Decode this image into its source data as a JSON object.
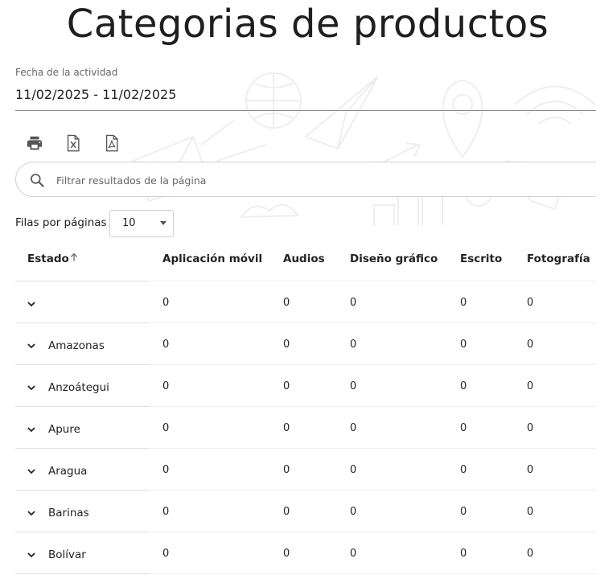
{
  "header": {
    "title": "Categorias de productos"
  },
  "filters": {
    "date_label": "Fecha de la actividad",
    "date_value": "11/02/2025 - 11/02/2025"
  },
  "search": {
    "placeholder": "Filtrar resultados de la página",
    "value": ""
  },
  "pagination": {
    "rows_label": "Filas por páginas",
    "rows_value": "10"
  },
  "table": {
    "columns": [
      "Estado",
      "Aplicación móvil",
      "Audios",
      "Diseño gráfico",
      "Escrito",
      "Fotografía"
    ],
    "sort": {
      "column": "Estado",
      "direction": "ascending"
    },
    "rows": [
      {
        "estado": "",
        "values": [
          "0",
          "0",
          "0",
          "0",
          "0"
        ]
      },
      {
        "estado": "Amazonas",
        "values": [
          "0",
          "0",
          "0",
          "0",
          "0"
        ]
      },
      {
        "estado": "Anzoátegui",
        "values": [
          "0",
          "0",
          "0",
          "0",
          "0"
        ]
      },
      {
        "estado": "Apure",
        "values": [
          "0",
          "0",
          "0",
          "0",
          "0"
        ]
      },
      {
        "estado": "Aragua",
        "values": [
          "0",
          "0",
          "0",
          "0",
          "0"
        ]
      },
      {
        "estado": "Barinas",
        "values": [
          "0",
          "0",
          "0",
          "0",
          "0"
        ]
      },
      {
        "estado": "Bolívar",
        "values": [
          "0",
          "0",
          "0",
          "0",
          "0"
        ]
      }
    ]
  },
  "icons": {
    "print": "print-icon",
    "excel": "excel-export-icon",
    "pdf": "pdf-export-icon",
    "search": "search-icon",
    "sort": "arrow-up-icon",
    "expand": "chevron-down-icon"
  }
}
